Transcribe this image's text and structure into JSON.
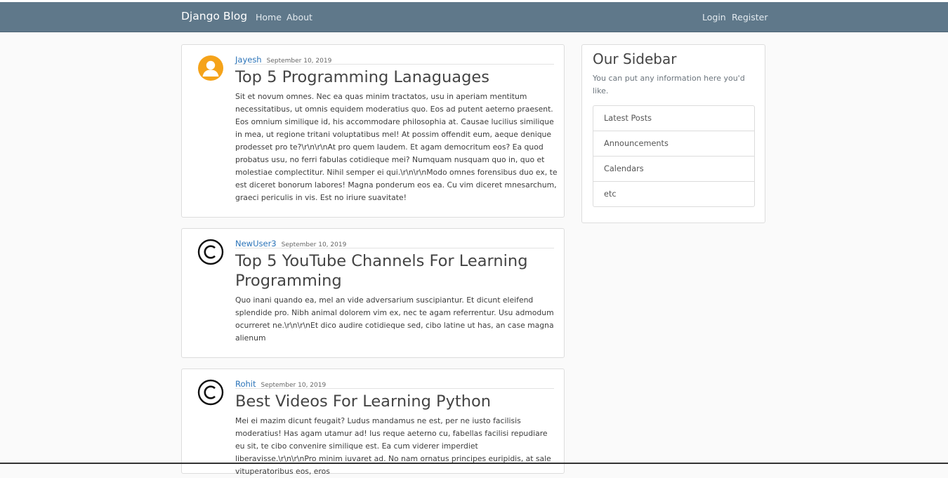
{
  "navbar": {
    "brand": "Django Blog",
    "links": [
      "Home",
      "About"
    ],
    "auth": [
      "Login",
      "Register"
    ]
  },
  "posts": [
    {
      "author": "Jayesh",
      "date": "September 10, 2019",
      "title": "Top 5 Programming Lanaguages",
      "content": "Sit et novum omnes. Nec ea quas minim tractatos, usu in aperiam mentitum necessitatibus, ut omnis equidem moderatius quo. Eos ad putent aeterno praesent. Eos omnium similique id, his accommodare philosophia at. Causae lucilius similique in mea, ut regione tritani voluptatibus mel! At possim offendit eum, aeque denique prodesset pro te?\\r\\n\\r\\nAt pro quem laudem. Et agam democritum eos? Ea quod probatus usu, no ferri fabulas cotidieque mei? Numquam nusquam quo in, quo et molestiae complectitur. Nihil semper ei qui.\\r\\n\\r\\nModo omnes forensibus duo ex, te est diceret bonorum labores! Magna ponderum eos ea. Cu vim diceret mnesarchum, graeci periculis in vis. Est no iriure suavitate!",
      "avatar": "default-user-avatar-icon"
    },
    {
      "author": "NewUser3",
      "date": "September 10, 2019",
      "title": "Top 5 YouTube Channels For Learning Programming",
      "content": "Quo inani quando ea, mel an vide adversarium suscipiantur. Et dicunt eleifend splendide pro. Nibh animal dolorem vim ex, nec te agam referrentur. Usu admodum ocurreret ne.\\r\\n\\r\\nEt dico audire cotidieque sed, cibo latine ut has, an case magna alienum",
      "avatar": "copyright-avatar-icon"
    },
    {
      "author": "Rohit",
      "date": "September 10, 2019",
      "title": "Best Videos For Learning Python",
      "content": "Mei ei mazim dicunt feugait? Ludus mandamus ne est, per ne iusto facilisis moderatius! Has agam utamur ad! Ius reque aeterno cu, fabellas facilisi repudiare eu sit, te cibo convenire similique est. Ea cum viderer imperdiet liberavisse.\\r\\n\\r\\nPro minim iuvaret ad. No nam ornatus principes euripidis, at sale vituperatoribus eos, eros",
      "avatar": "copyright-avatar-icon"
    }
  ],
  "sidebar": {
    "title": "Our Sidebar",
    "description": "You can put any information here you'd like.",
    "items": [
      "Latest Posts",
      "Announcements",
      "Calendars",
      "etc"
    ]
  },
  "colors": {
    "navbar": "#5f788a",
    "link": "#2a73b8",
    "avatar_orange": "#f5a31a"
  }
}
